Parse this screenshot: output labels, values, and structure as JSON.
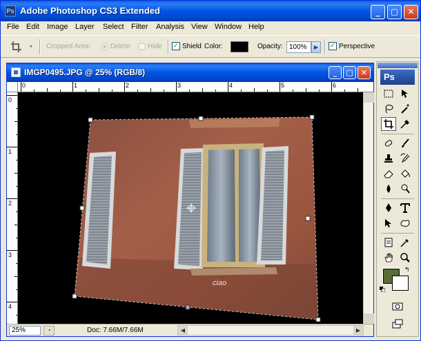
{
  "app": {
    "title": "Adobe Photoshop CS3 Extended",
    "icon_label": "Ps",
    "window_controls": [
      "minimize",
      "maximize",
      "close"
    ]
  },
  "menu": [
    "File",
    "Edit",
    "Image",
    "Layer",
    "Select",
    "Filter",
    "Analysis",
    "View",
    "Window",
    "Help"
  ],
  "options_bar": {
    "tool_icon": "crop-icon",
    "cropped_area_label": "Cropped Area:",
    "delete_label": "Delete",
    "hide_label": "Hide",
    "selected_option": "Delete",
    "shield_label": "Shield",
    "shield_checked": true,
    "color_label": "Color:",
    "shield_color": "#000000",
    "opacity_label": "Opacity:",
    "opacity_value": "100%",
    "perspective_label": "Perspective",
    "perspective_checked": true
  },
  "document": {
    "title": "IMGP0495.JPG @ 25% (RGB/8)",
    "ruler_h_labels": [
      "0",
      "1",
      "2",
      "3",
      "4",
      "5",
      "6"
    ],
    "ruler_v_labels": [
      "0",
      "1",
      "2",
      "3",
      "4"
    ],
    "zoom": "25%",
    "doc_info": "Doc: 7.66M/7.66M"
  },
  "tools_palette": {
    "logo": "Ps",
    "tools": [
      "marquee-icon",
      "move-icon",
      "lasso-icon",
      "magic-wand-icon",
      "crop-icon",
      "eyedropper-icon",
      "healing-brush-icon",
      "brush-icon",
      "clone-stamp-icon",
      "history-brush-icon",
      "eraser-icon",
      "paint-bucket-icon",
      "blur-icon",
      "dodge-icon",
      "pen-icon",
      "type-icon",
      "path-selection-icon",
      "shape-icon",
      "notes-icon",
      "eyedropper-2-icon",
      "hand-icon",
      "zoom-icon"
    ],
    "selected_tool": "crop-icon",
    "foreground_color": "#5A6B33",
    "background_color": "#FFFFFF"
  }
}
